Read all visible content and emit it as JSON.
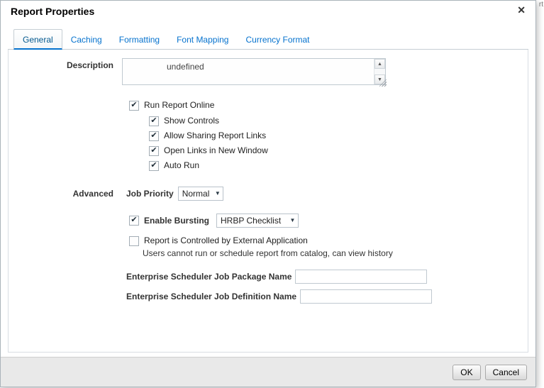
{
  "background": {
    "fragment": "rt"
  },
  "dialog": {
    "title": "Report Properties"
  },
  "icons": {
    "close": "✕",
    "check": "✔",
    "dropdown_arrow": "▼",
    "scroll_up": "▲",
    "scroll_down": "▼"
  },
  "tabs": {
    "items": [
      {
        "label": "General",
        "active": true
      },
      {
        "label": "Caching",
        "active": false
      },
      {
        "label": "Formatting",
        "active": false
      },
      {
        "label": "Font Mapping",
        "active": false
      },
      {
        "label": "Currency Format",
        "active": false
      }
    ]
  },
  "form": {
    "description": {
      "label": "Description",
      "value": "undefined"
    },
    "run_report_online": {
      "label": "Run Report Online",
      "checked": true
    },
    "sub_options": [
      {
        "label": "Show Controls",
        "checked": true
      },
      {
        "label": "Allow Sharing Report Links",
        "checked": true
      },
      {
        "label": "Open Links in New Window",
        "checked": true
      },
      {
        "label": "Auto Run",
        "checked": true
      }
    ],
    "advanced_label": "Advanced",
    "job_priority": {
      "label": "Job Priority",
      "value": "Normal"
    },
    "enable_bursting": {
      "label": "Enable Bursting",
      "checked": true,
      "value": "HRBP Checklist"
    },
    "external_app": {
      "label": "Report is Controlled by External Application",
      "checked": false,
      "help_text": "Users cannot run or schedule report from catalog, can view history"
    },
    "job_package": {
      "label": "Enterprise Scheduler Job Package Name",
      "value": ""
    },
    "job_definition": {
      "label": "Enterprise Scheduler Job Definition Name",
      "value": ""
    }
  },
  "footer": {
    "ok_label": "OK",
    "cancel_label": "Cancel"
  }
}
